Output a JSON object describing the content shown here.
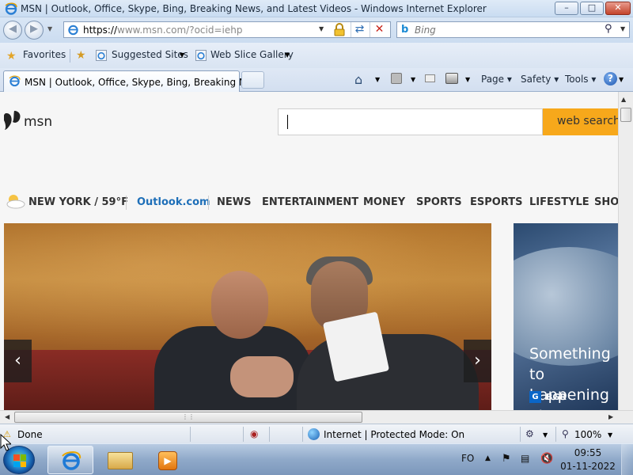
{
  "window": {
    "title": "MSN | Outlook, Office, Skype, Bing, Breaking News, and Latest Videos - Windows Internet Explorer",
    "minimize": "–",
    "maximize": "□",
    "close": "✕"
  },
  "address_bar": {
    "url_prefix": "https://",
    "url_host": "www.msn.com",
    "url_rest": "/?ocid=iehp"
  },
  "search": {
    "placeholder": "Bing"
  },
  "favorites_bar": {
    "favorites_label": "Favorites",
    "items": [
      {
        "label": "Suggested Sites"
      },
      {
        "label": "Web Slice Gallery"
      }
    ]
  },
  "tabs": [
    {
      "label": "MSN | Outlook, Office, Skype, Bing, Breaking Ne..."
    }
  ],
  "command_bar": {
    "page": "Page ▾",
    "safety": "Safety ▾",
    "tools": "Tools ▾",
    "help": "?"
  },
  "page": {
    "logo_text": "msn",
    "search_button": "web search",
    "weather": "NEW YORK / 59°F",
    "nav": {
      "outlook": "Outlook.com",
      "news": "NEWS",
      "entertainment": "ENTERTAINMENT",
      "money": "MONEY",
      "sports": "SPORTS",
      "esports": "ESPORTS",
      "lifestyle": "LIFESTYLE",
      "shopping": "SHOI"
    },
    "hero_prev": "‹",
    "hero_next": "›",
    "side_card": {
      "headline": "Something to happening at",
      "source_icon": "G",
      "source": "BGR"
    }
  },
  "status_bar": {
    "status": "Done",
    "zone": "Internet | Protected Mode: On",
    "zoom": "100%"
  },
  "taskbar": {
    "language": "FO",
    "time": "09:55",
    "date": "01-11-2022"
  },
  "colors": {
    "msn_search_button": "#f7a81b",
    "outlook_link": "#1e6fb8",
    "close_button": "#c3432b"
  }
}
